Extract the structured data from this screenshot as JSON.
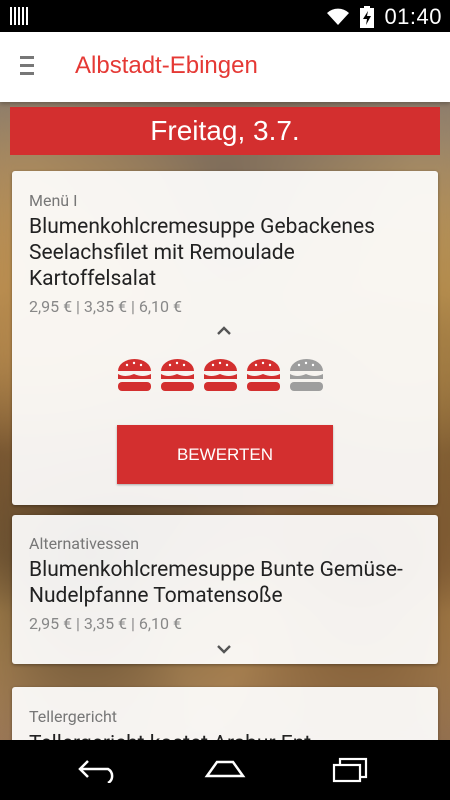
{
  "status_bar": {
    "time": "01:40",
    "icons": [
      "barcode-icon",
      "wifi-icon",
      "battery-charging-icon"
    ]
  },
  "app_bar": {
    "title": "Albstadt-Ebingen",
    "menu_icon": "menu-icon"
  },
  "date_banner": {
    "label": "Freitag, 3.7."
  },
  "cards": [
    {
      "category": "Menü I",
      "meal": "Blumenkohlcremesuppe Gebackenes Seelachsfilet mit Remoulade Kartoffelsalat",
      "prices": "2,95 € | 3,35 € | 6,10 €",
      "rating": {
        "value": 4,
        "max": 5
      },
      "rate_button": "BEWERTEN"
    },
    {
      "category": "Alternativessen",
      "meal": "Blumenkohlcremesuppe Bunte Gemüse-Nudelpfanne Tomatensoße",
      "prices": "2,95 € | 3,35 € | 6,10 €"
    },
    {
      "category": "Tellergericht",
      "meal": "Tellergericht kostet Arabur Ent..."
    }
  ],
  "colors": {
    "accent": "#d32f2f",
    "title_red": "#e53935",
    "rating_inactive": "#9e9e9e"
  },
  "nav_bar": {
    "icons": [
      "back-icon",
      "home-icon",
      "recent-apps-icon"
    ]
  }
}
